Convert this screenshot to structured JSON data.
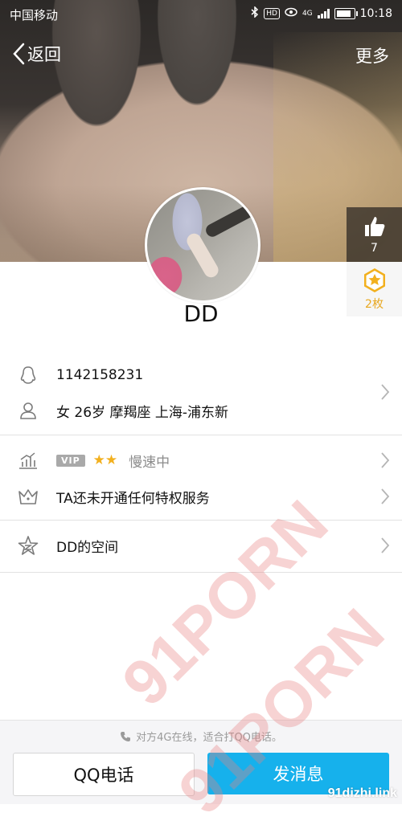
{
  "status_bar": {
    "carrier": "中国移动",
    "network": "4G",
    "time": "10:18"
  },
  "nav": {
    "back_label": "返回",
    "more_label": "更多"
  },
  "side": {
    "like_count": "7",
    "medal_count": "2枚"
  },
  "profile": {
    "name": "DD",
    "qq_number": "1142158231",
    "info": "女  26岁  摩羯座  上海-浦东新"
  },
  "vip": {
    "badge": "VIP",
    "stars": "★★",
    "speed": "慢速中",
    "privilege_text": "TA还未开通任何特权服务"
  },
  "space": {
    "label": "DD的空间"
  },
  "bottom": {
    "online_text": "对方4G在线，适合打QQ电话。",
    "call_label": "QQ电话",
    "message_label": "发消息"
  },
  "watermark": {
    "text1": "91PORN",
    "text2": "91PORN",
    "link": "91dizhi.link"
  },
  "colors": {
    "accent": "#16b1ec",
    "star": "#f2b01e",
    "medal": "#e8a820"
  }
}
